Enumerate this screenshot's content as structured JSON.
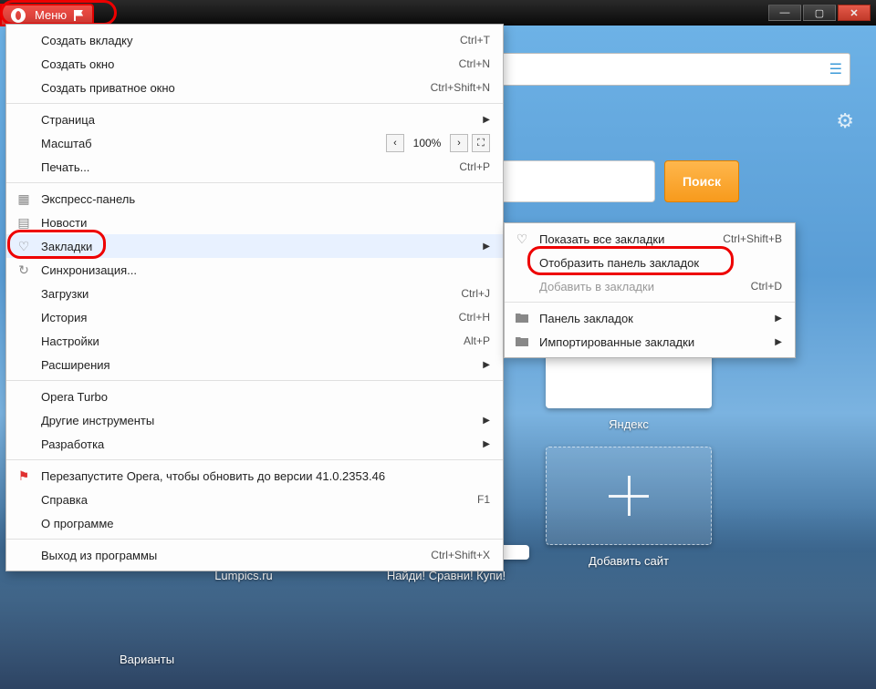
{
  "menu_button": "Меню",
  "window_controls": {
    "min": "—",
    "max": "▢",
    "close": "✕"
  },
  "search_button": "Поиск",
  "tiles": {
    "yandex": "Яндекс",
    "lumpics": "Lumpics.ru",
    "naydi": "Найди! Сравни! Купи!",
    "add": "Добавить сайт",
    "variants": "Варианты"
  },
  "zoom_value": "100%",
  "main_menu": [
    {
      "id": "new_tab",
      "label": "Создать вкладку",
      "shortcut": "Ctrl+T"
    },
    {
      "id": "new_window",
      "label": "Создать окно",
      "shortcut": "Ctrl+N"
    },
    {
      "id": "new_private",
      "label": "Создать приватное окно",
      "shortcut": "Ctrl+Shift+N"
    },
    {
      "sep": true
    },
    {
      "id": "page",
      "label": "Страница",
      "submenu": true
    },
    {
      "id": "zoom",
      "label": "Масштаб",
      "zoom": true
    },
    {
      "id": "print",
      "label": "Печать...",
      "shortcut": "Ctrl+P"
    },
    {
      "sep": true
    },
    {
      "id": "speeddial",
      "label": "Экспресс-панель",
      "icon": "grid"
    },
    {
      "id": "news",
      "label": "Новости",
      "icon": "news"
    },
    {
      "id": "bookmarks",
      "label": "Закладки",
      "icon": "heart",
      "submenu": true,
      "hover": true,
      "hl": true
    },
    {
      "id": "sync",
      "label": "Синхронизация...",
      "icon": "sync"
    },
    {
      "id": "downloads",
      "label": "Загрузки",
      "shortcut": "Ctrl+J"
    },
    {
      "id": "history",
      "label": "История",
      "shortcut": "Ctrl+H"
    },
    {
      "id": "settings",
      "label": "Настройки",
      "shortcut": "Alt+P"
    },
    {
      "id": "extensions",
      "label": "Расширения",
      "submenu": true
    },
    {
      "sep": true
    },
    {
      "id": "turbo",
      "label": "Opera Turbo"
    },
    {
      "id": "other_tools",
      "label": "Другие инструменты",
      "submenu": true
    },
    {
      "id": "dev",
      "label": "Разработка",
      "submenu": true
    },
    {
      "sep": true
    },
    {
      "id": "restart",
      "label": "Перезапустите Opera, чтобы обновить до версии 41.0.2353.46",
      "icon": "flag"
    },
    {
      "id": "help",
      "label": "Справка",
      "shortcut": "F1"
    },
    {
      "id": "about",
      "label": "О программе"
    },
    {
      "sep": true
    },
    {
      "id": "exit",
      "label": "Выход из программы",
      "shortcut": "Ctrl+Shift+X"
    }
  ],
  "sub_menu": [
    {
      "id": "show_all",
      "label": "Показать все закладки",
      "shortcut": "Ctrl+Shift+B",
      "icon": "heart"
    },
    {
      "id": "show_panel",
      "label": "Отобразить панель закладок",
      "hl": true
    },
    {
      "id": "add_bm",
      "label": "Добавить в закладки",
      "shortcut": "Ctrl+D",
      "disabled": true
    },
    {
      "sep": true
    },
    {
      "id": "bm_panel",
      "label": "Панель закладок",
      "icon": "folder",
      "submenu": true
    },
    {
      "id": "imported",
      "label": "Импортированные закладки",
      "icon": "folder",
      "submenu": true
    }
  ]
}
